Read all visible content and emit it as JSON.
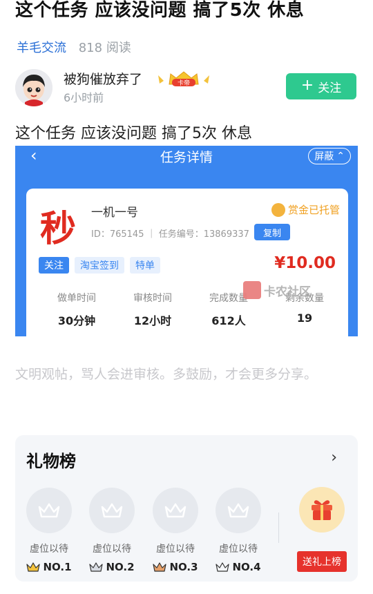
{
  "post": {
    "title": "这个任务 应该没问题 搞了5次 休息",
    "category": "羊毛交流",
    "reads": "818 阅读",
    "body": "这个任务 应该没问题 搞了5次 休息"
  },
  "author": {
    "name": "被狗催放弃了",
    "time": "6小时前",
    "badge_label": "卡帝",
    "follow_label": "关注"
  },
  "screenshot": {
    "header_title": "任务详情",
    "block_label": "屏蔽",
    "task_char": "秒",
    "task_name": "一机一号",
    "escrow": "赏金已托管",
    "task_id_line": "ID：765145 ｜ 任务编号：13869337",
    "copy_label": "复制",
    "tags": [
      "关注",
      "淘宝签到",
      "特单"
    ],
    "price": "¥10.00",
    "stats": [
      {
        "label": "做单时间",
        "value": "30分钟"
      },
      {
        "label": "审核时间",
        "value": "12小时"
      },
      {
        "label": "完成数量",
        "value": "612人"
      },
      {
        "label": "剩余数量",
        "value": "19"
      }
    ],
    "watermark": "卡农社区"
  },
  "notice": "文明观帖，骂人会进审核。多鼓励，才会更多分享。",
  "gifts": {
    "title": "礼物榜",
    "slots": [
      {
        "label": "虚位以待",
        "rank": "NO.1"
      },
      {
        "label": "虚位以待",
        "rank": "NO.2"
      },
      {
        "label": "虚位以待",
        "rank": "NO.3"
      },
      {
        "label": "虚位以待",
        "rank": "NO.4"
      }
    ],
    "send_label": "送礼上榜"
  }
}
